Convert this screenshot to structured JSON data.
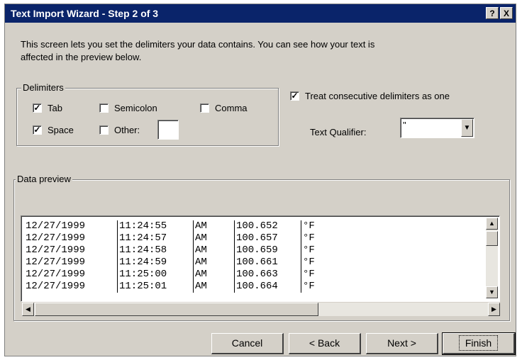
{
  "window": {
    "title": "Text Import Wizard - Step 2 of 3",
    "help_label": "?",
    "close_label": "X"
  },
  "intro_text": "This screen lets you set the delimiters your data contains.  You can see how your text is affected in the preview below.",
  "delimiters": {
    "group_label": "Delimiters",
    "tab": {
      "label": "Tab",
      "checked": true
    },
    "semicolon": {
      "label": "Semicolon",
      "checked": false
    },
    "comma": {
      "label": "Comma",
      "checked": false
    },
    "space": {
      "label": "Space",
      "checked": true
    },
    "other": {
      "label": "Other:",
      "checked": false,
      "value": ""
    }
  },
  "consecutive": {
    "label": "Treat consecutive delimiters as one",
    "checked": true
  },
  "text_qualifier": {
    "label": "Text Qualifier:",
    "value": "\""
  },
  "preview": {
    "group_label": "Data preview",
    "rows": [
      [
        "12/27/1999",
        "11:24:55",
        "AM",
        "100.652",
        "°F"
      ],
      [
        "12/27/1999",
        "11:24:57",
        "AM",
        "100.657",
        "°F"
      ],
      [
        "12/27/1999",
        "11:24:58",
        "AM",
        "100.659",
        "°F"
      ],
      [
        "12/27/1999",
        "11:24:59",
        "AM",
        "100.661",
        "°F"
      ],
      [
        "12/27/1999",
        "11:25:00",
        "AM",
        "100.663",
        "°F"
      ],
      [
        "12/27/1999",
        "11:25:01",
        "AM",
        "100.664",
        "°F"
      ]
    ]
  },
  "buttons": {
    "cancel": "Cancel",
    "back": "< Back",
    "next": "Next >",
    "finish": "Finish"
  },
  "colors": {
    "titlebar": "#0a246a",
    "face": "#d4d0c8"
  }
}
